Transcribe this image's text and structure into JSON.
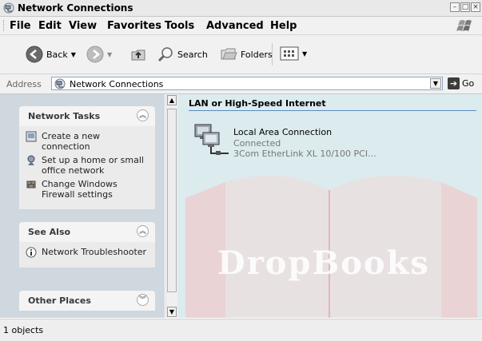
{
  "window": {
    "title": "Network Connections",
    "controls": [
      "minimize",
      "maximize",
      "close"
    ]
  },
  "menubar": {
    "items": [
      {
        "label": "File"
      },
      {
        "label": "Edit"
      },
      {
        "label": "View"
      },
      {
        "label": "Favorites"
      },
      {
        "label": "Tools"
      },
      {
        "label": "Advanced"
      },
      {
        "label": "Help"
      }
    ]
  },
  "toolbar": {
    "back_label": "Back",
    "search_label": "Search",
    "folders_label": "Folders"
  },
  "address": {
    "label": "Address",
    "value": "Network Connections",
    "go_label": "Go"
  },
  "network_tasks": {
    "title": "Network Tasks",
    "items": [
      {
        "label": "Create a new connection"
      },
      {
        "label": "Set up a home or small office network"
      },
      {
        "label": "Change Windows Firewall settings"
      }
    ]
  },
  "see_also": {
    "title": "See Also",
    "items": [
      {
        "label": "Network Troubleshooter"
      }
    ]
  },
  "other_places": {
    "title": "Other Places"
  },
  "content": {
    "group_title": "LAN or High-Speed Internet",
    "connection": {
      "name": "Local Area Connection",
      "status": "Connected",
      "device": "3Com EtherLink XL 10/100 PCI..."
    }
  },
  "watermark": "DropBooks",
  "statusbar": {
    "text": "1 objects"
  },
  "colors": {
    "left_pane": "#cfd7df",
    "right_pane": "#dcebee",
    "group_rule": "#5b8bbf"
  }
}
